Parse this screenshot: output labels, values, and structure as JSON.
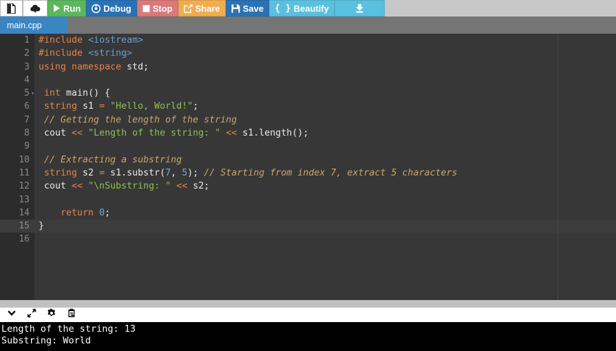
{
  "toolbar": {
    "buttons": [
      {
        "id": "new-file",
        "label": "",
        "icon": "file-icon",
        "style": "white"
      },
      {
        "id": "open-file",
        "label": "",
        "icon": "cloud-upload-icon",
        "style": "white"
      },
      {
        "id": "run",
        "label": "Run",
        "icon": "play-icon",
        "style": "green"
      },
      {
        "id": "debug",
        "label": "Debug",
        "icon": "debug-circle-icon",
        "style": "blue"
      },
      {
        "id": "stop",
        "label": "Stop",
        "icon": "stop-square-icon",
        "style": "red"
      },
      {
        "id": "share",
        "label": "Share",
        "icon": "share-icon",
        "style": "orange"
      },
      {
        "id": "save",
        "label": "Save",
        "icon": "floppy-disk-icon",
        "style": "blue"
      },
      {
        "id": "beautify",
        "label": "Beautify",
        "icon": "braces-icon",
        "style": "beautify"
      },
      {
        "id": "download",
        "label": "",
        "icon": "download-icon",
        "style": "cyan"
      }
    ],
    "colors": {
      "background": "#c8c8c8",
      "green": "#5cb85c",
      "blue": "#2a72b5",
      "red": "#d9797a",
      "orange": "#f0ad4e",
      "cyan": "#5bc0de"
    }
  },
  "tabs": {
    "active_index": 0,
    "items": [
      {
        "label": "main.cpp"
      }
    ],
    "bar_color": "#757575",
    "active_color": "#3b85c3"
  },
  "editor": {
    "language": "cpp",
    "active_line": 15,
    "gutter_numbers": [
      "1",
      "2",
      "3",
      "4",
      "5",
      "6",
      "7",
      "8",
      "9",
      "10",
      "11",
      "12",
      "13",
      "14",
      "15",
      "16"
    ],
    "fold_lines": [
      5
    ],
    "lines": [
      {
        "n": 1,
        "tokens": [
          {
            "t": "#include ",
            "c": "pre"
          },
          {
            "t": "<iostream>",
            "c": "inc"
          }
        ]
      },
      {
        "n": 2,
        "tokens": [
          {
            "t": "#include ",
            "c": "pre"
          },
          {
            "t": "<string>",
            "c": "inc"
          }
        ]
      },
      {
        "n": 3,
        "tokens": [
          {
            "t": "using namespace ",
            "c": "kw"
          },
          {
            "t": "std;",
            "c": "id"
          }
        ]
      },
      {
        "n": 4,
        "tokens": []
      },
      {
        "n": 5,
        "tokens": [
          {
            "t": " int ",
            "c": "kw"
          },
          {
            "t": "main",
            "c": "id"
          },
          {
            "t": "() {",
            "c": "punc"
          }
        ]
      },
      {
        "n": 6,
        "tokens": [
          {
            "t": " string",
            "c": "kw"
          },
          {
            "t": " s1 ",
            "c": "id"
          },
          {
            "t": "=",
            "c": "op"
          },
          {
            "t": " ",
            "c": "id"
          },
          {
            "t": "\"Hello, World!\"",
            "c": "str"
          },
          {
            "t": ";",
            "c": "punc"
          }
        ]
      },
      {
        "n": 7,
        "tokens": [
          {
            "t": " // Getting the length of the string",
            "c": "cmt"
          }
        ]
      },
      {
        "n": 8,
        "tokens": [
          {
            "t": " cout ",
            "c": "id"
          },
          {
            "t": "<<",
            "c": "op"
          },
          {
            "t": " ",
            "c": "id"
          },
          {
            "t": "\"Length of the string: \"",
            "c": "str"
          },
          {
            "t": " ",
            "c": "id"
          },
          {
            "t": "<<",
            "c": "op"
          },
          {
            "t": " s1.length();",
            "c": "id"
          }
        ]
      },
      {
        "n": 9,
        "tokens": []
      },
      {
        "n": 10,
        "tokens": [
          {
            "t": " // Extracting a substring",
            "c": "cmt"
          }
        ]
      },
      {
        "n": 11,
        "tokens": [
          {
            "t": " string",
            "c": "kw"
          },
          {
            "t": " s2 ",
            "c": "id"
          },
          {
            "t": "=",
            "c": "op"
          },
          {
            "t": " s1.substr(",
            "c": "id"
          },
          {
            "t": "7",
            "c": "num"
          },
          {
            "t": ", ",
            "c": "punc"
          },
          {
            "t": "5",
            "c": "num"
          },
          {
            "t": "); ",
            "c": "punc"
          },
          {
            "t": "// Starting from index 7, extract 5 characters",
            "c": "cmt"
          }
        ]
      },
      {
        "n": 12,
        "tokens": [
          {
            "t": " cout ",
            "c": "id"
          },
          {
            "t": "<<",
            "c": "op"
          },
          {
            "t": " ",
            "c": "id"
          },
          {
            "t": "\"\\nSubstring: \"",
            "c": "str"
          },
          {
            "t": " ",
            "c": "id"
          },
          {
            "t": "<<",
            "c": "op"
          },
          {
            "t": " s2;",
            "c": "id"
          }
        ]
      },
      {
        "n": 13,
        "tokens": []
      },
      {
        "n": 14,
        "tokens": [
          {
            "t": "    return ",
            "c": "kw"
          },
          {
            "t": "0",
            "c": "num"
          },
          {
            "t": ";",
            "c": "punc"
          }
        ]
      },
      {
        "n": 15,
        "tokens": [
          {
            "t": "}",
            "c": "punc"
          }
        ]
      },
      {
        "n": 16,
        "tokens": []
      }
    ],
    "colors": {
      "background": "#373737",
      "gutter": "#2c2c2c",
      "active_line": "#3c3c3c",
      "preprocessor": "#e8834a",
      "include_path": "#6a9fd4",
      "string": "#8fbf56",
      "comment": "#c9a76a",
      "number": "#6ab0d8",
      "text": "#eaeaea"
    }
  },
  "console": {
    "toolbar_buttons": [
      {
        "id": "collapse",
        "icon": "chevron-down-icon"
      },
      {
        "id": "expand",
        "icon": "expand-arrows-icon"
      },
      {
        "id": "settings",
        "icon": "gear-icon"
      },
      {
        "id": "paste",
        "icon": "clipboard-paste-icon"
      }
    ],
    "output_lines": [
      "Length of the string: 13",
      "Substring: World"
    ],
    "colors": {
      "background": "#000000",
      "text": "#ffffff"
    }
  }
}
